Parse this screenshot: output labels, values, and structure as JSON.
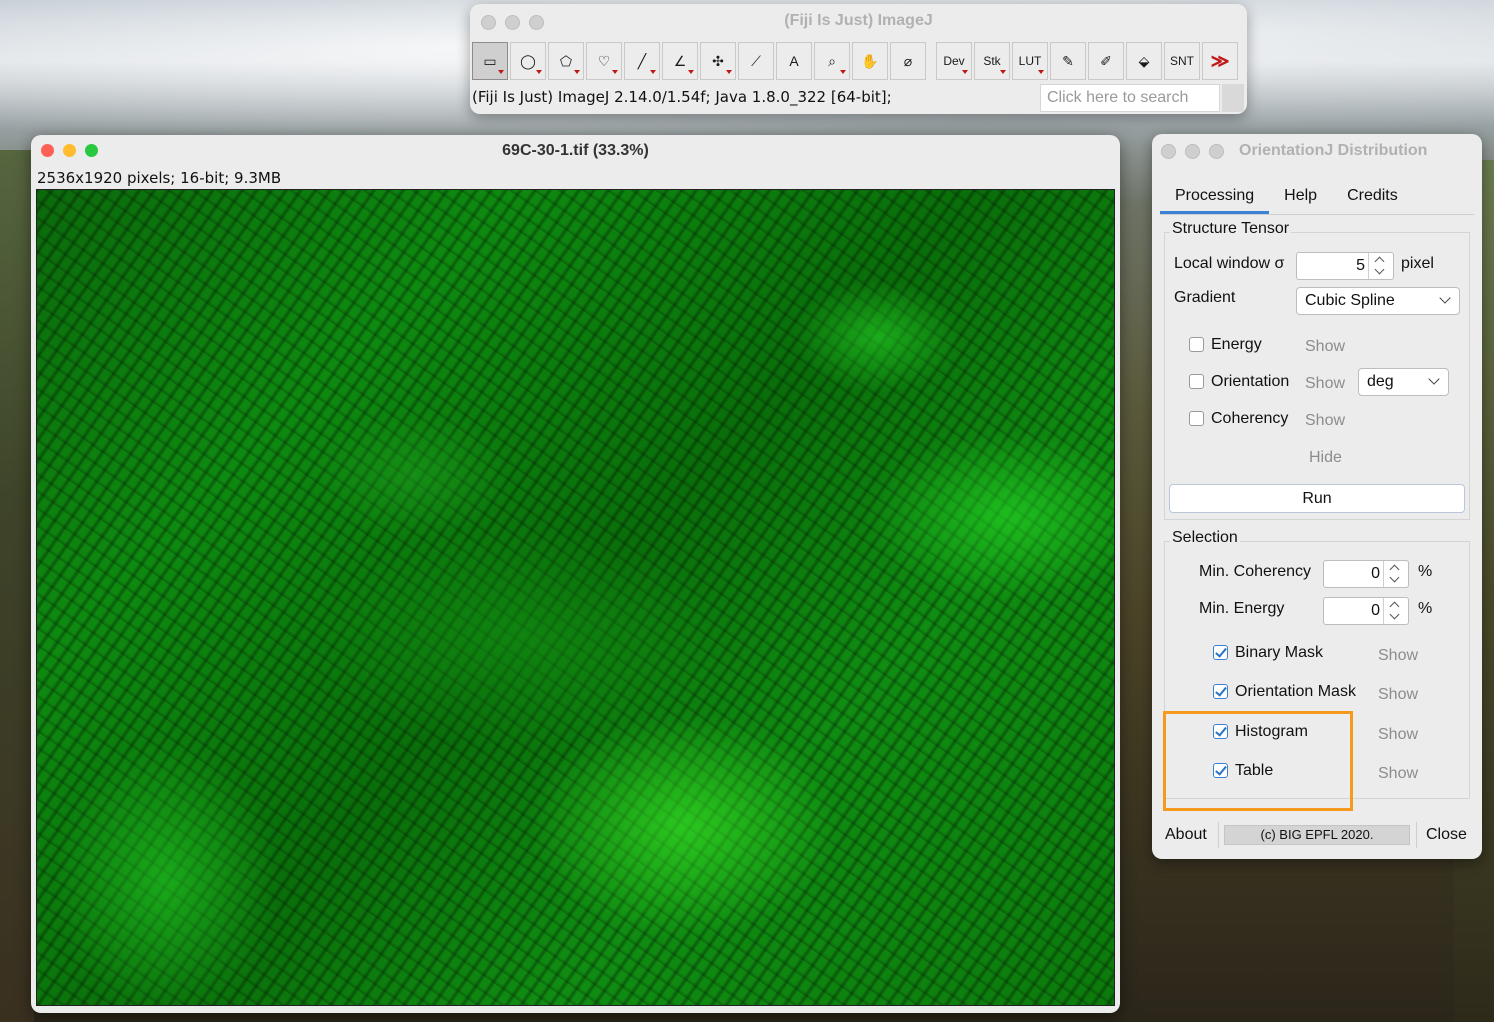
{
  "imagej": {
    "title": "(Fiji Is Just) ImageJ",
    "status": "(Fiji Is Just) ImageJ 2.14.0/1.54f; Java 1.8.0_322 [64-bit];",
    "search_placeholder": "Click here to search",
    "tools": [
      {
        "name": "rectangle-tool",
        "glyph": "▭"
      },
      {
        "name": "oval-tool",
        "glyph": "◯"
      },
      {
        "name": "polygon-tool",
        "glyph": "⬠"
      },
      {
        "name": "freehand-tool",
        "glyph": "♡"
      },
      {
        "name": "line-tool",
        "glyph": "╱"
      },
      {
        "name": "angle-tool",
        "glyph": "∠"
      },
      {
        "name": "multipoint-tool",
        "glyph": "✣"
      },
      {
        "name": "wand-tool",
        "glyph": "⟋"
      },
      {
        "name": "text-tool",
        "glyph": "A"
      },
      {
        "name": "magnifier-tool",
        "glyph": "⌕"
      },
      {
        "name": "hand-tool",
        "glyph": "✋"
      },
      {
        "name": "dropper-tool",
        "glyph": "⌀"
      },
      {
        "name": "dev-menu",
        "glyph": "Dev"
      },
      {
        "name": "stack-menu",
        "glyph": "Stk"
      },
      {
        "name": "lut-menu",
        "glyph": "LUT"
      },
      {
        "name": "pencil-tool",
        "glyph": "✎"
      },
      {
        "name": "brush-tool",
        "glyph": "✐"
      },
      {
        "name": "flood-fill-tool",
        "glyph": "⬙"
      },
      {
        "name": "snt-tool",
        "glyph": "SNT"
      },
      {
        "name": "more-tools",
        "glyph": "≫"
      }
    ]
  },
  "image_window": {
    "title": "69C-30-1.tif (33.3%)",
    "info": "2536x1920 pixels; 16-bit; 9.3MB"
  },
  "orientationj": {
    "title": "OrientationJ Distribution",
    "tabs": [
      "Processing",
      "Help",
      "Credits"
    ],
    "structure_tensor": {
      "heading": "Structure Tensor",
      "local_window_label": "Local window σ",
      "local_window_value": "5",
      "local_window_unit": "pixel",
      "gradient_label": "Gradient",
      "gradient_value": "Cubic Spline",
      "energy_label": "Energy",
      "orientation_label": "Orientation",
      "orientation_unit": "deg",
      "coherency_label": "Coherency",
      "show": "Show",
      "hide": "Hide",
      "run": "Run"
    },
    "selection": {
      "heading": "Selection",
      "min_coherency_label": "Min. Coherency",
      "min_coherency_value": "0",
      "min_energy_label": "Min. Energy",
      "min_energy_value": "0",
      "percent": "%",
      "binary_mask": "Binary Mask",
      "orientation_mask": "Orientation Mask",
      "histogram": "Histogram",
      "table": "Table",
      "show": "Show"
    },
    "footer": {
      "about": "About",
      "copyright": "(c) BIG EPFL 2020.",
      "close": "Close"
    }
  }
}
